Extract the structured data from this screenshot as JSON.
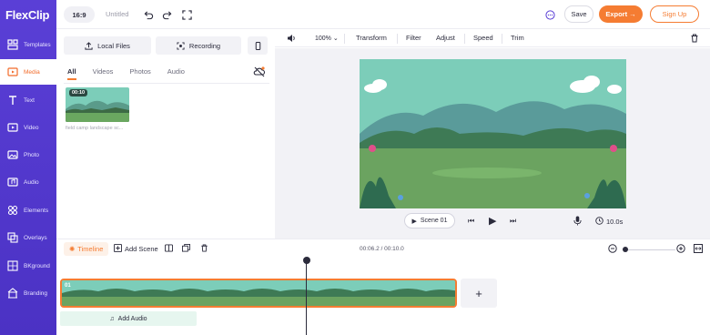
{
  "brand": {
    "logo_text": "FlexClip",
    "colors": {
      "sidebar": "#5a3fd6",
      "accent": "#f57c32"
    }
  },
  "sidebar": {
    "items": [
      {
        "label": "Templates",
        "icon": "templates-icon"
      },
      {
        "label": "Media",
        "icon": "media-icon"
      },
      {
        "label": "Text",
        "icon": "text-icon"
      },
      {
        "label": "Video",
        "icon": "video-icon"
      },
      {
        "label": "Photo",
        "icon": "photo-icon"
      },
      {
        "label": "Audio",
        "icon": "audio-icon"
      },
      {
        "label": "Elements",
        "icon": "elements-icon"
      },
      {
        "label": "Overlays",
        "icon": "overlays-icon"
      },
      {
        "label": "BKground",
        "icon": "background-icon"
      },
      {
        "label": "Branding",
        "icon": "branding-icon"
      }
    ],
    "active": "Media"
  },
  "header": {
    "ratio": "16:9",
    "project_title": "Untitled",
    "save_label": "Save",
    "export_label": "Export →",
    "signup_label": "Sign Up"
  },
  "media": {
    "local_files_label": "Local Files",
    "recording_label": "Recording",
    "tabs": [
      "All",
      "Videos",
      "Photos",
      "Audio"
    ],
    "active_tab": "All",
    "item": {
      "duration": "00:10",
      "name": "field camp landscape sc..."
    }
  },
  "edit_toolbar": {
    "zoom": "100%",
    "items": [
      "Transform",
      "Filter",
      "Adjust",
      "Speed",
      "Trim"
    ]
  },
  "preview": {
    "scene_label": "Scene 01",
    "duration": "10.0s"
  },
  "timeline": {
    "tab_label": "Timeline",
    "add_scene_label": "Add Scene",
    "time": "00:06.2 / 00:10.0",
    "clip_number": "01",
    "add_plus": "+",
    "add_audio_label": "Add Audio"
  }
}
